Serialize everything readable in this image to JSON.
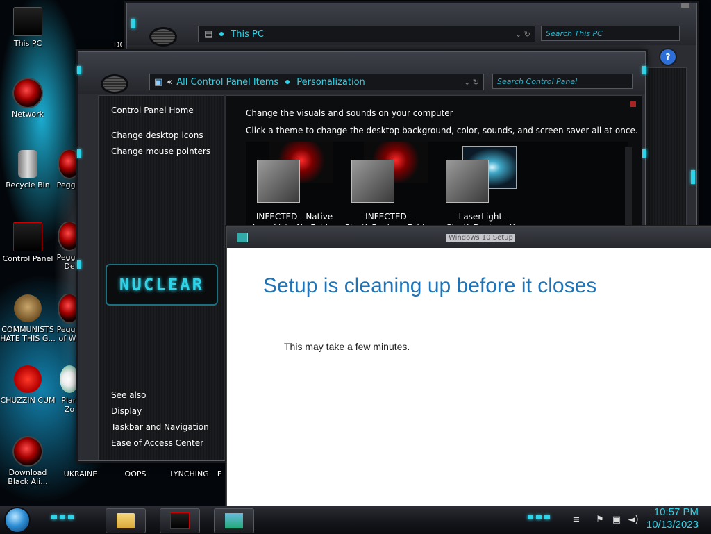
{
  "desktop": {
    "icons": [
      {
        "label": "This PC"
      },
      {
        "label": "DC"
      },
      {
        "label": "Network"
      },
      {
        "label": "Recycle Bin"
      },
      {
        "label": "Peggle"
      },
      {
        "label": "Control Panel"
      },
      {
        "label": "Peggle De"
      },
      {
        "label": "COMMUNISTS HATE THIS G..."
      },
      {
        "label": "Peggle of Wa"
      },
      {
        "label": "CHUZZIN CUM"
      },
      {
        "label": "Plan Zo"
      },
      {
        "label": "Download Black Ali..."
      },
      {
        "label": "UKRAINE"
      },
      {
        "label": "OOPS"
      },
      {
        "label": "LYNCHING"
      },
      {
        "label": "F"
      }
    ]
  },
  "explorer": {
    "address": "This PC",
    "search_placeholder": "Search This PC"
  },
  "control_panel": {
    "breadcrumb_back": "«",
    "breadcrumb_1": "All Control Panel Items",
    "breadcrumb_2": "Personalization",
    "search_placeholder": "Search Control Panel",
    "sidebar": {
      "home": "Control Panel Home",
      "links": [
        "Change desktop icons",
        "Change mouse pointers"
      ],
      "logo": "NUCLEAR",
      "see_also_title": "See also",
      "see_also": [
        "Display",
        "Taskbar and Navigation",
        "Ease of Access Center"
      ]
    },
    "heading": "Change the visuals and sounds on your computer",
    "subheading": "Click a theme to change the desktop background, color, sounds, and screen saver all at once.",
    "themes": [
      {
        "line1": "INFECTED - Native",
        "line2": "JumpList - No Folder"
      },
      {
        "line1": "INFECTED -",
        "line2": "StartIsBack+ - Folder"
      },
      {
        "line1": "LaserLight -",
        "line2": "StartIsBack+ - No"
      }
    ]
  },
  "setup": {
    "window_title": "Windows 10 Setup",
    "heading": "Setup is cleaning up before it closes",
    "message": "This may take a few minutes."
  },
  "taskbar": {
    "time": "10:57 PM",
    "date": "10/13/2023"
  },
  "colors": {
    "accent": "#2fd3e8",
    "setup_heading": "#1f74b8"
  }
}
